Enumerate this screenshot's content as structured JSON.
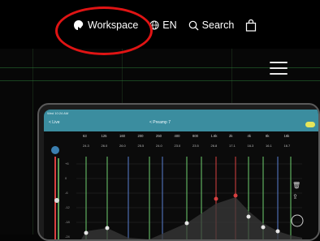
{
  "nav": {
    "workspace_label": "Workspace",
    "language_label": "EN",
    "search_label": "Search"
  },
  "tablet": {
    "status_text": "Wed 10:24 AM",
    "back_label": "< Live",
    "preset_title": "< Preamp 7",
    "frequencies": [
      "63",
      "125",
      "160",
      "200",
      "250",
      "400",
      "800",
      "1.6k",
      "2k",
      "4k",
      "8k",
      "16k"
    ],
    "gain_values": [
      "24.3",
      "26.0",
      "26.0",
      "25.5",
      "24.0",
      "23.0",
      "23.5",
      "26.8",
      "17.1",
      "16.3",
      "16.1",
      "16.7"
    ],
    "scale_labels": [
      "+6",
      "0",
      "-6",
      "-12",
      "-18",
      "-24"
    ]
  },
  "colors": {
    "highlight": "#e01414",
    "app_header": "#3b8d9f",
    "red_fader": "#d84040",
    "green_fader": "#6fcf6f"
  }
}
